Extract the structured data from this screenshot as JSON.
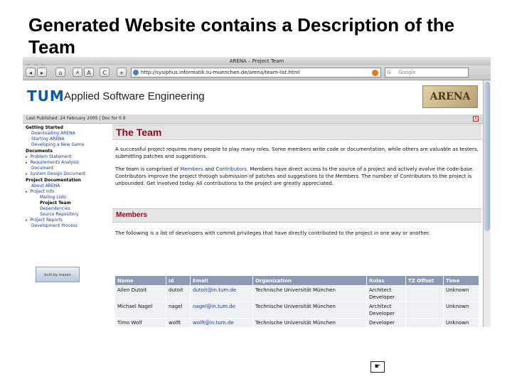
{
  "slide": {
    "title": "Generated Website contains a Description of the Team"
  },
  "browser": {
    "window_title": "ARENA – Project Team",
    "toolbar": {
      "back": "◂",
      "forward": "▸",
      "home": "⌂",
      "font_smaller": "A",
      "font_larger": "A",
      "reload": "C",
      "add": "+"
    },
    "url": "http://sysiphus.informatik.tu-muenchen.de/arena/team-list.html",
    "search_engine_glyph": "G",
    "search_placeholder": "Google"
  },
  "page": {
    "header": {
      "logo_text": "TUM",
      "site_title": "Applied Software Engineering",
      "arena_logo_text": "ARENA"
    },
    "status": {
      "text": "Last Published: 24 February 2005 | Doc for 0.9",
      "close_glyph": "x"
    },
    "sidebar": {
      "items": [
        {
          "label": "Getting Started",
          "level": 0
        },
        {
          "label": "Downloading ARENA",
          "level": 1
        },
        {
          "label": "Starting ARENA",
          "level": 1
        },
        {
          "label": "Developing a New Game",
          "level": 1
        },
        {
          "label": "Documents",
          "level": 0
        },
        {
          "label": "Problem Statement",
          "level": 1,
          "arrow": true
        },
        {
          "label": "Requirements Analysis",
          "level": 1,
          "arrow": true
        },
        {
          "label": "Document",
          "level": 1
        },
        {
          "label": "System Design Document",
          "level": 1,
          "arrow": true
        },
        {
          "label": "Project Documentation",
          "level": 0
        },
        {
          "label": "About ARENA",
          "level": 1
        },
        {
          "label": "Project Info",
          "level": 1,
          "arrow": true
        },
        {
          "label": "Mailing Lists",
          "level": 2
        },
        {
          "label": "Project Team",
          "level": 2,
          "active": true
        },
        {
          "label": "Dependencies",
          "level": 2
        },
        {
          "label": "Source Repository",
          "level": 2
        },
        {
          "label": "Project Reports",
          "level": 1,
          "arrow": true
        },
        {
          "label": "Development Process",
          "level": 1
        }
      ],
      "banner_text": "built by maven"
    },
    "main": {
      "heading": "The Team",
      "para1": "A successful project requires many people to play many roles. Some members write code or documentation, while others are valuable as testers, submitting patches and suggestions.",
      "para2_prefix": "The team is comprised of ",
      "para2_link1": "Members",
      "para2_and": " and ",
      "para2_link2": "Contributors",
      "para2_suffix": ". Members have direct access to the source of a project and actively evolve the code-base. Contributors improve the project through submission of patches and suggestions to the Members. The number of Contributors to the project is unbounded. Get involved today. All contributions to the project are greatly appreciated.",
      "members_heading": "Members",
      "members_text": "The following is a list of developers with commit privileges that have directly contributed to the project in one way or another.",
      "table": {
        "headers": [
          "Name",
          "Id",
          "Email",
          "Organization",
          "Roles",
          "TZ Offset",
          "Time"
        ],
        "rows": [
          [
            "Allen Dutoit",
            "dutoit",
            "dutoit@in.tum.de",
            "Technische Universität München",
            "Architect Developer",
            "",
            "Unknown"
          ],
          [
            "Michael Nagel",
            "nagel",
            "nagel@in.tum.de",
            "Technische Universität München",
            "Architect Developer",
            "",
            "Unknown"
          ],
          [
            "Timo Wolf",
            "wolft",
            "wolft@in.tum.de",
            "Technische Universität München",
            "Developer",
            "",
            "Unknown"
          ]
        ]
      }
    }
  },
  "slide_nav_glyph": "☛"
}
